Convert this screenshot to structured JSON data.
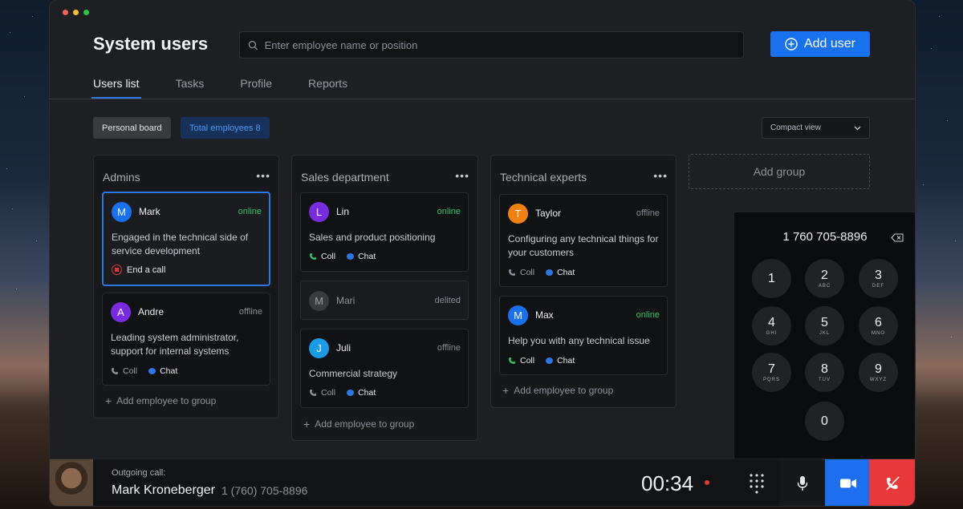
{
  "window": {
    "traffic_lights": [
      "#ff5f57",
      "#febc2e",
      "#28c840"
    ]
  },
  "header": {
    "title": "System users",
    "search_placeholder": "Enter employee name or position",
    "add_user_label": "Add user"
  },
  "tabs": [
    {
      "label": "Users list",
      "active": true
    },
    {
      "label": "Tasks",
      "active": false
    },
    {
      "label": "Profile",
      "active": false
    },
    {
      "label": "Reports",
      "active": false
    }
  ],
  "filters": {
    "personal_board": "Personal board",
    "total_employees": "Total employees 8",
    "view_select": "Compact view"
  },
  "columns": [
    {
      "title": "Admins",
      "add_employee": "Add employee to group",
      "cards": [
        {
          "initial": "M",
          "avatar_color": "#1872f0",
          "name": "Mark",
          "status": "online",
          "desc": "Engaged in the technical side of service development",
          "action": "End a call"
        },
        {
          "initial": "A",
          "avatar_color": "#7a2be0",
          "name": "Andre",
          "status": "offline",
          "desc": "Leading system administrator, support for internal systems",
          "coll": "Coll",
          "chat": "Chat"
        }
      ]
    },
    {
      "title": "Sales department",
      "add_employee": "Add employee to group",
      "cards": [
        {
          "initial": "L",
          "avatar_color": "#7a2be0",
          "name": "Lin",
          "status": "online",
          "desc": "Sales and product positioning",
          "coll": "Coll",
          "chat": "Chat"
        },
        {
          "initial": "M",
          "avatar_color": "#3a3b3f",
          "name": "Mari",
          "status": "delited"
        },
        {
          "initial": "J",
          "avatar_color": "#1a9be8",
          "name": "Juli",
          "status": "offline",
          "desc": "Commercial strategy",
          "coll": "Coll",
          "chat": "Chat"
        }
      ]
    },
    {
      "title": "Technical experts",
      "add_employee": "Add employee to group",
      "cards": [
        {
          "initial": "T",
          "avatar_color": "#f2800c",
          "name": "Taylor",
          "status": "offline",
          "desc": "Configuring any technical things for your customers",
          "coll": "Coll",
          "chat": "Chat"
        },
        {
          "initial": "M",
          "avatar_color": "#1872f0",
          "name": "Max",
          "status": "online",
          "desc": "Help you with any technical issue",
          "coll": "Coll",
          "chat": "Chat"
        }
      ]
    }
  ],
  "add_group_label": "Add group",
  "dialer": {
    "number": "1 760 705-8896",
    "keys": [
      {
        "digit": "1",
        "letters": ""
      },
      {
        "digit": "2",
        "letters": "ABC"
      },
      {
        "digit": "3",
        "letters": "DEF"
      },
      {
        "digit": "4",
        "letters": "GHI"
      },
      {
        "digit": "5",
        "letters": "JKL"
      },
      {
        "digit": "6",
        "letters": "MNO"
      },
      {
        "digit": "7",
        "letters": "PQRS"
      },
      {
        "digit": "8",
        "letters": "TUV"
      },
      {
        "digit": "9",
        "letters": "WXYZ"
      },
      {
        "digit": "0",
        "letters": ""
      }
    ]
  },
  "call": {
    "label": "Outgoing call:",
    "name": "Mark Kroneberger",
    "phone": "1 (760) 705-8896",
    "timer": "00:34"
  },
  "colors": {
    "accent": "#1872f0",
    "online": "#33c26a",
    "hangup": "#e8383a"
  }
}
